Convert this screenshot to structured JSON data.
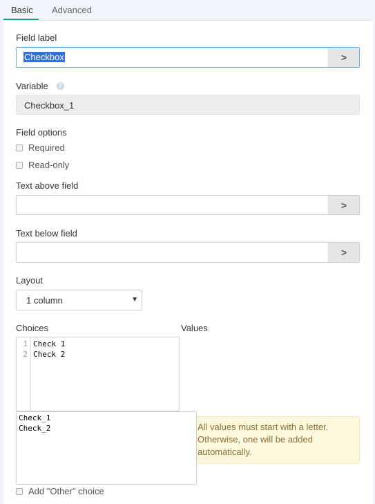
{
  "tabs": [
    {
      "label": "Basic",
      "active": true
    },
    {
      "label": "Advanced",
      "active": false
    }
  ],
  "field_label": {
    "label": "Field label",
    "value": "Checkbox",
    "button": ">"
  },
  "variable": {
    "label": "Variable",
    "help_icon": "question-circle-icon",
    "help_glyph": "?",
    "value": "Checkbox_1"
  },
  "field_options": {
    "label": "Field options",
    "options": [
      {
        "label": "Required",
        "checked": false
      },
      {
        "label": "Read-only",
        "checked": false
      }
    ]
  },
  "text_above": {
    "label": "Text above field",
    "value": "",
    "button": ">"
  },
  "text_below": {
    "label": "Text below field",
    "value": "",
    "button": ">"
  },
  "layout": {
    "label": "Layout",
    "selected": "1 column",
    "arrow": "▼"
  },
  "choices": {
    "label": "Choices",
    "line_numbers": [
      "1",
      "2"
    ],
    "lines": [
      "Check 1",
      "Check 2"
    ]
  },
  "values": {
    "label": "Values",
    "lines": [
      "Check_1",
      "Check_2"
    ],
    "note": "All values must start with a letter. Otherwise, one will be added automatically."
  },
  "other_choice": {
    "label": "Add \"Other\" choice",
    "checked": false
  },
  "colors": {
    "accent": "#1a9e7d",
    "selection": "#3470d8",
    "note_bg": "#fcf8dc"
  }
}
